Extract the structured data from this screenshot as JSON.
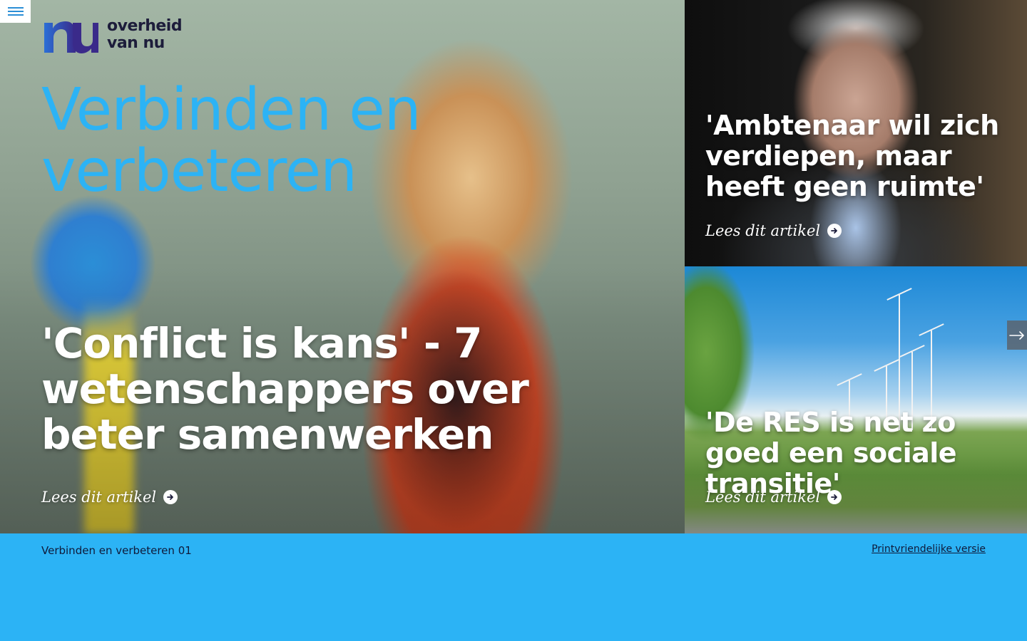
{
  "nav": {
    "menu_icon": "hamburger-icon"
  },
  "logo": {
    "line1": "overheid",
    "line2": "van nu",
    "mark": "nu"
  },
  "hero": {
    "tagline_line1": "Verbinden en",
    "tagline_line2": "verbeteren",
    "title": "'Conflict is kans' - 7 wetenschappers over beter samenwerken",
    "read_more": "Lees dit artikel"
  },
  "cards": [
    {
      "title": "'Ambtenaar wil zich verdiepen, maar heeft geen ruimte'",
      "read_more": "Lees dit artikel"
    },
    {
      "title": "'De RES is net zo goed een sociale transitie'",
      "read_more": "Lees dit artikel"
    }
  ],
  "carousel": {
    "next_icon": "arrow-right-icon"
  },
  "footer": {
    "issue_label": "Verbinden en verbeteren 01",
    "print_link": "Printvriendelijke versie"
  },
  "colors": {
    "accent": "#2cb3f5",
    "logo_blue": "#2b6fd6",
    "logo_purple": "#3a2a8a",
    "text_dark": "#0f1a3a"
  }
}
